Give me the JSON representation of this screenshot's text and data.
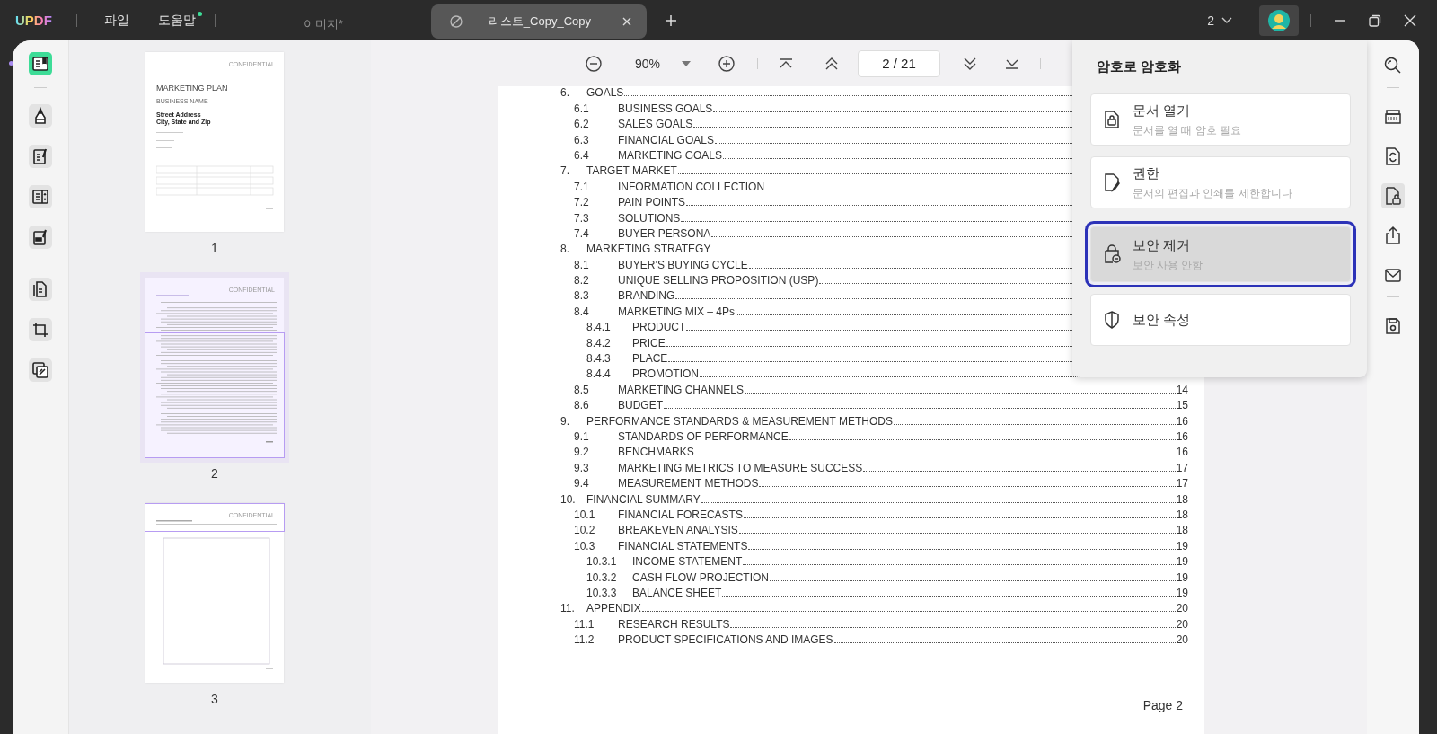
{
  "app": {
    "logo": "UPDF",
    "menus": [
      {
        "label": "파일",
        "badge": false
      },
      {
        "label": "도움말",
        "badge": true
      }
    ]
  },
  "tabs": [
    {
      "label": "이미지*",
      "selected": false
    },
    {
      "label": "리스트_Copy_Copy",
      "selected": true
    }
  ],
  "window_count": "2",
  "left_tools": [
    {
      "selected": true
    },
    {
      "selected": false
    },
    {
      "selected": false
    },
    {
      "selected": false
    },
    {
      "selected": false
    },
    {
      "selected": false
    },
    {
      "selected": false
    },
    {
      "selected": false
    }
  ],
  "right_tools": [
    {
      "selected": false
    },
    {
      "selected": false
    },
    {
      "selected": false
    },
    {
      "selected": true
    },
    {
      "selected": false
    },
    {
      "selected": false
    },
    {
      "selected": false
    }
  ],
  "toolbar": {
    "zoom": "90%",
    "page_field": "2 / 21"
  },
  "thumbnails": [
    {
      "kind": "cover",
      "label": "1",
      "selected": false,
      "header": "CONFIDENTIAL",
      "title": "MARKETING PLAN",
      "subtitle": "BUSINESS NAME",
      "address": [
        "Street Address",
        "City, State and Zip"
      ]
    },
    {
      "kind": "toc",
      "label": "2",
      "selected": true,
      "header": "CONFIDENTIAL"
    },
    {
      "kind": "body",
      "label": "3",
      "selected": false,
      "header": "CONFIDENTIAL"
    }
  ],
  "document": {
    "toc": [
      {
        "num": "6.",
        "title": "GOALS",
        "children": [
          {
            "num": "6.1",
            "title": "BUSINESS GOALS"
          },
          {
            "num": "6.2",
            "title": "SALES GOALS"
          },
          {
            "num": "6.3",
            "title": "FINANCIAL GOALS"
          },
          {
            "num": "6.4",
            "title": "MARKETING GOALS"
          }
        ]
      },
      {
        "num": "7.",
        "title": "TARGET MARKET",
        "children": [
          {
            "num": "7.1",
            "title": "INFORMATION COLLECTION"
          },
          {
            "num": "7.2",
            "title": "PAIN POINTS"
          },
          {
            "num": "7.3",
            "title": "SOLUTIONS"
          },
          {
            "num": "7.4",
            "title": "BUYER PERSONA"
          }
        ]
      },
      {
        "num": "8.",
        "title": "MARKETING STRATEGY",
        "children": [
          {
            "num": "8.1",
            "title": "BUYER’S BUYING CYCLE"
          },
          {
            "num": "8.2",
            "title": "UNIQUE SELLING PROPOSITION (USP)"
          },
          {
            "num": "8.3",
            "title": "BRANDING"
          },
          {
            "num": "8.4",
            "title": "MARKETING MIX – 4Ps",
            "children": [
              {
                "num": "8.4.1",
                "title": "PRODUCT"
              },
              {
                "num": "8.4.2",
                "title": "PRICE"
              },
              {
                "num": "8.4.3",
                "title": "PLACE"
              },
              {
                "num": "8.4.4",
                "title": "PROMOTION"
              }
            ]
          },
          {
            "num": "8.5",
            "title": "MARKETING CHANNELS",
            "page": "14"
          },
          {
            "num": "8.6",
            "title": "BUDGET",
            "page": "15"
          }
        ]
      },
      {
        "num": "9.",
        "title": "PERFORMANCE STANDARDS & MEASUREMENT METHODS",
        "page": "16",
        "children": [
          {
            "num": "9.1",
            "title": "STANDARDS OF PERFORMANCE",
            "page": "16"
          },
          {
            "num": "9.2",
            "title": "BENCHMARKS",
            "page": "16"
          },
          {
            "num": "9.3",
            "title": "MARKETING METRICS TO MEASURE SUCCESS",
            "page": "17"
          },
          {
            "num": "9.4",
            "title": "MEASUREMENT METHODS",
            "page": "17"
          }
        ]
      },
      {
        "num": "10.",
        "title": "FINANCIAL SUMMARY",
        "page": "18",
        "children": [
          {
            "num": "10.1",
            "title": "FINANCIAL FORECASTS",
            "page": "18"
          },
          {
            "num": "10.2",
            "title": "BREAKEVEN ANALYSIS",
            "page": "18"
          },
          {
            "num": "10.3",
            "title": "FINANCIAL STATEMENTS",
            "page": "19",
            "children": [
              {
                "num": "10.3.1",
                "title": "INCOME STATEMENT",
                "page": "19"
              },
              {
                "num": "10.3.2",
                "title": "CASH FLOW PROJECTION",
                "page": "19"
              },
              {
                "num": "10.3.3",
                "title": "BALANCE SHEET",
                "page": "19"
              }
            ]
          }
        ]
      },
      {
        "num": "11.",
        "title": "APPENDIX",
        "page": "20",
        "children": [
          {
            "num": "11.1",
            "title": "RESEARCH RESULTS",
            "page": "20"
          },
          {
            "num": "11.2",
            "title": "PRODUCT SPECIFICATIONS AND IMAGES",
            "page": "20"
          }
        ]
      }
    ],
    "footer": "Page 2"
  },
  "popup": {
    "title": "암호로 암호화",
    "options": [
      {
        "title": "문서 열기",
        "subtitle": "문서를 열 때 암호 필요",
        "selected": false
      },
      {
        "title": "권한",
        "subtitle": "문서의 편집과 인쇄를 제한합니다",
        "selected": false
      },
      {
        "title": "보안 제거",
        "subtitle": "보안 사용 안함",
        "selected": true
      },
      {
        "title": "보안 속성",
        "selected": false
      }
    ]
  }
}
